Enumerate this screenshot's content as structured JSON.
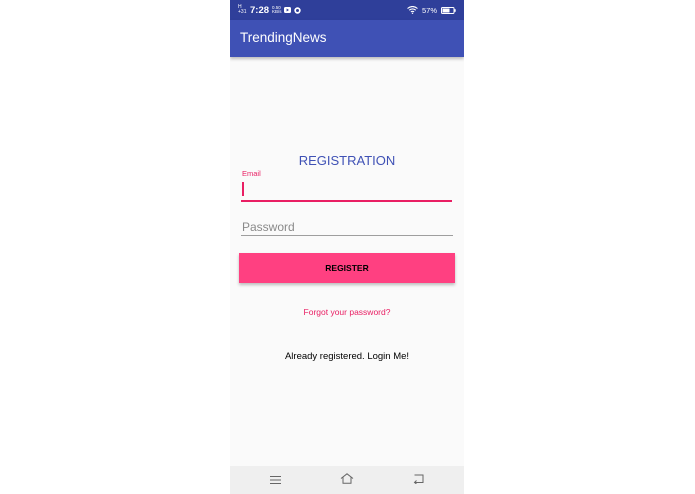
{
  "status_bar": {
    "network": "H\n+31",
    "time": "7:28",
    "speed": "0.50\nKB/s",
    "battery_percent": "57%",
    "icons": [
      "youtube-icon",
      "sync-icon",
      "wifi-icon",
      "battery-icon"
    ]
  },
  "app_bar": {
    "title": "TrendingNews"
  },
  "form": {
    "heading": "REGISTRATION",
    "email_label": "Email",
    "email_value": "",
    "password_placeholder": "Password",
    "password_value": "",
    "register_label": "REGISTER",
    "forgot_link": "Forgot your password?",
    "login_link": "Already registered. Login Me!"
  },
  "nav_bar": {
    "icons": [
      "menu-icon",
      "home-icon",
      "back-icon"
    ]
  },
  "colors": {
    "primary": "#3f51b5",
    "primary_dark": "#2f3f9a",
    "accent": "#ff4081",
    "accent_text": "#e91e63"
  }
}
